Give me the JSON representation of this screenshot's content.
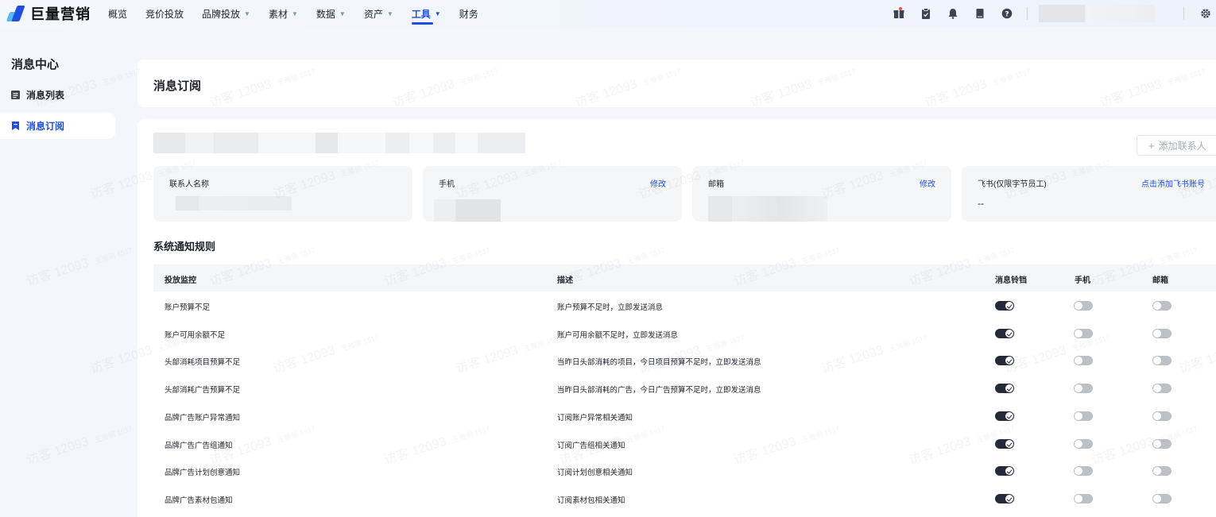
{
  "app": {
    "logo_text": "巨量营销"
  },
  "nav": [
    {
      "label": "概览",
      "caret": false,
      "active": false
    },
    {
      "label": "竞价投放",
      "caret": false,
      "active": false
    },
    {
      "label": "品牌投放",
      "caret": true,
      "active": false
    },
    {
      "label": "素材",
      "caret": true,
      "active": false
    },
    {
      "label": "数据",
      "caret": true,
      "active": false
    },
    {
      "label": "资产",
      "caret": true,
      "active": false
    },
    {
      "label": "工具",
      "caret": true,
      "active": true
    },
    {
      "label": "财务",
      "caret": false,
      "active": false
    }
  ],
  "topbar_icons": [
    "gift-icon",
    "clipboard-icon",
    "bell-icon",
    "book-icon",
    "help-icon",
    "settings-icon"
  ],
  "sidebar": {
    "title": "消息中心",
    "items": [
      {
        "label": "消息列表",
        "icon": "list-icon"
      },
      {
        "label": "消息订阅",
        "icon": "bookmark-icon"
      }
    ]
  },
  "page": {
    "title": "消息订阅"
  },
  "contact": {
    "add_button": "添加联系人",
    "name_label": "联系人名称",
    "phone_label": "手机",
    "phone_action": "修改",
    "email_label": "邮箱",
    "email_action": "修改",
    "feishu_label": "飞书(仅限字节员工)",
    "feishu_action": "点击添加飞书账号",
    "feishu_value": "--"
  },
  "rules": {
    "section_title": "系统通知规则",
    "columns": [
      "投放监控",
      "描述",
      "消息铃铛",
      "手机",
      "邮箱"
    ],
    "rows": [
      {
        "name": "账户预算不足",
        "desc": "账户预算不足时，立即发送消息",
        "bell": true,
        "phone": false,
        "email": false
      },
      {
        "name": "账户可用余额不足",
        "desc": "账户可用余额不足时，立即发送消息",
        "bell": true,
        "phone": false,
        "email": false
      },
      {
        "name": "头部消耗项目预算不足",
        "desc": "当昨日头部消耗的项目，今日项目预算不足时，立即发送消息",
        "bell": true,
        "phone": false,
        "email": false
      },
      {
        "name": "头部消耗广告预算不足",
        "desc": "当昨日头部消耗的广告，今日广告预算不足时，立即发送消息",
        "bell": true,
        "phone": false,
        "email": false
      },
      {
        "name": "品牌广告账户异常通知",
        "desc": "订阅账户异常相关通知",
        "bell": true,
        "phone": false,
        "email": false
      },
      {
        "name": "品牌广告广告组通知",
        "desc": "订阅广告组相关通知",
        "bell": true,
        "phone": false,
        "email": false
      },
      {
        "name": "品牌广告计划创意通知",
        "desc": "订阅计划创意相关通知",
        "bell": true,
        "phone": false,
        "email": false
      },
      {
        "name": "品牌广告素材包通知",
        "desc": "订阅素材包相关通知",
        "bell": true,
        "phone": false,
        "email": false
      }
    ]
  },
  "watermark": {
    "main": "访客 12093",
    "sub": "王雅丽 1517"
  },
  "colors": {
    "accent": "#1d4fe0",
    "toggle_on": "#242a3a",
    "toggle_off": "#bcc0c7"
  }
}
